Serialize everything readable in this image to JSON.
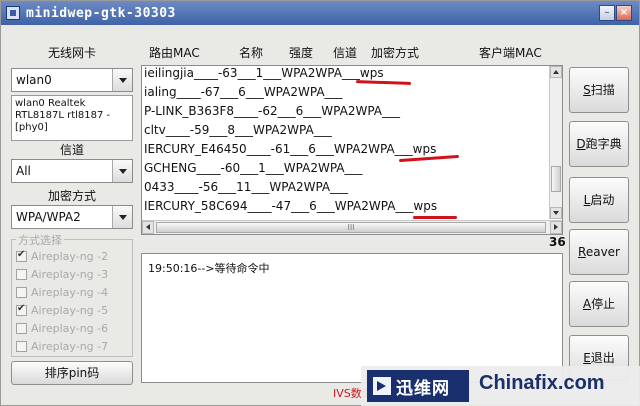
{
  "window": {
    "title": "minidwep-gtk-30303",
    "minimize_glyph": "–",
    "close_glyph": "×"
  },
  "left_panel": {
    "nic_label": "无线网卡",
    "nic_value": "wlan0",
    "nic_info": "wlan0 Realtek RTL8187L rtl8187 - [phy0]",
    "channel_label": "信道",
    "channel_value": "All",
    "encryption_label": "加密方式",
    "encryption_value": "WPA/WPA2",
    "method_group_title": "方式选择",
    "methods": [
      {
        "label": "Aireplay-ng -2",
        "checked": true
      },
      {
        "label": "Aireplay-ng -3",
        "checked": false
      },
      {
        "label": "Aireplay-ng -4",
        "checked": false
      },
      {
        "label": "Aireplay-ng -5",
        "checked": true
      },
      {
        "label": "Aireplay-ng -6",
        "checked": false
      },
      {
        "label": "Aireplay-ng -7",
        "checked": false
      }
    ],
    "sort_pin_button": "排序pin码"
  },
  "table": {
    "headers": [
      "路由MAC",
      "名称",
      "强度",
      "信道",
      "加密方式",
      "客户端MAC"
    ],
    "rows": [
      "ieilingjia____-63___1___WPA2WPA___wps",
      "ialing____-67___6___WPA2WPA___",
      "P-LINK_B363F8____-62___6___WPA2WPA___",
      "cltv____-59___8___WPA2WPA___",
      "IERCURY_E46450____-61___6___WPA2WPA___wps",
      "GCHENG____-60___1___WPA2WPA___",
      "0433____-56___11___WPA2WPA___",
      "IERCURY_58C694____-47___6___WPA2WPA___wps"
    ],
    "scroll_grip": "III",
    "count": "36"
  },
  "log": {
    "line": "19:50:16-->等待命令中"
  },
  "ivs_label": "IVS数量",
  "buttons": {
    "scan": {
      "key": "S",
      "rest": "扫描"
    },
    "dict": {
      "key": "D",
      "rest": "跑字典"
    },
    "start": {
      "key": "L",
      "rest": "启动"
    },
    "reaver": {
      "key": "R",
      "rest": "eaver"
    },
    "stop": {
      "key": "A",
      "rest": "停止"
    },
    "exit": {
      "key": "E",
      "rest": "退出"
    }
  },
  "watermark": {
    "logo_text": "迅维网",
    "site": "Chinafix.com"
  },
  "colors": {
    "titlebar": "#3f63a8",
    "annotation_red": "#d0121a",
    "ivs_red": "#c8191e",
    "watermark_blue": "#1a2f6e"
  }
}
